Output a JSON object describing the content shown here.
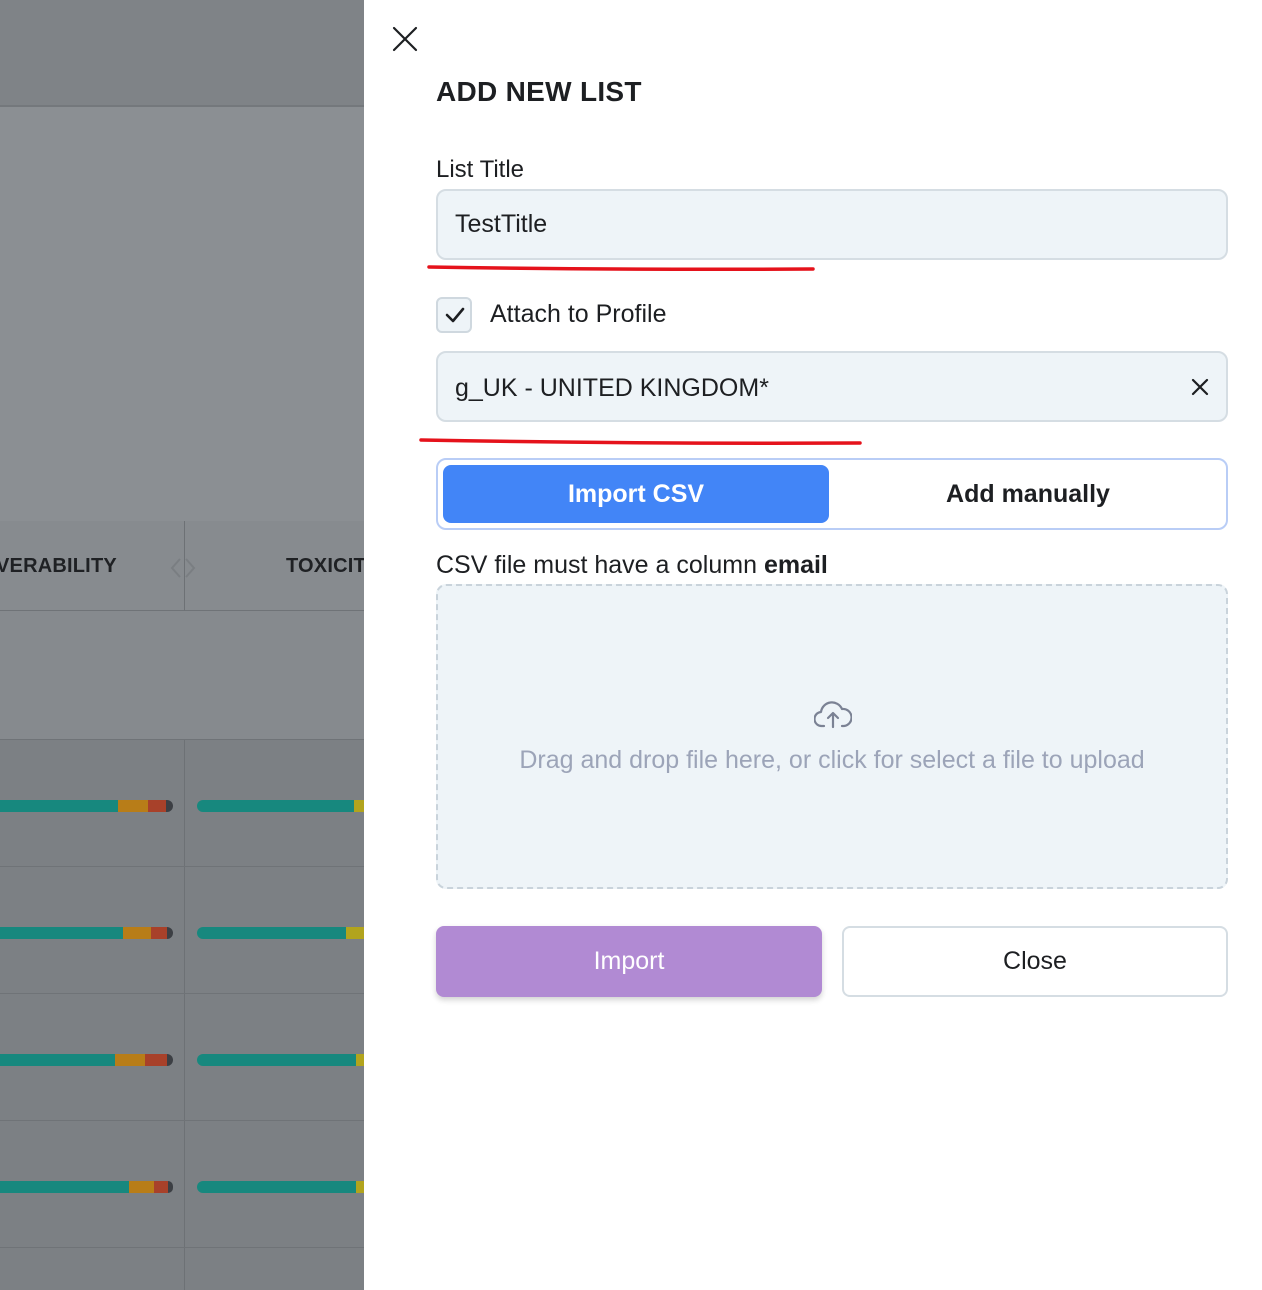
{
  "background": {
    "columns": [
      "VERABILITY",
      "TOXICIT"
    ],
    "colors": {
      "teal": "#17887e",
      "orange": "#b87d18",
      "red": "#a8412a",
      "dark": "#3c3f44",
      "yellow": "#b2a41d"
    }
  },
  "drawer": {
    "title": "ADD NEW LIST",
    "list_title_label": "List Title",
    "list_title_value": "TestTitle",
    "attach_checked": true,
    "attach_label": "Attach to Profile",
    "profile_value": "g_UK - UNITED KINGDOM*",
    "tabs": [
      {
        "label": "Import CSV",
        "active": true
      },
      {
        "label": "Add manually",
        "active": false
      }
    ],
    "hint_prefix": "CSV file must have a column",
    "hint_bold": "email",
    "dropzone_text": "Drag and drop file here, or click for select a file to upload",
    "import_label": "Import",
    "close_label": "Close",
    "annotation_color": "#e5121b",
    "accent_color": "#4285f7",
    "import_button_color": "#b18ad3"
  }
}
